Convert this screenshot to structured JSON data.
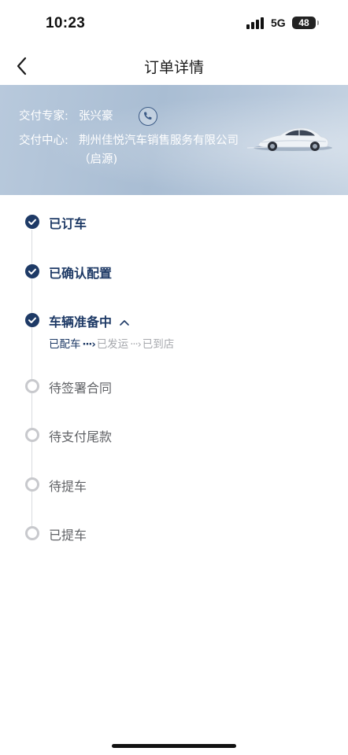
{
  "status_bar": {
    "time": "10:23",
    "network": "5G",
    "battery": "48"
  },
  "nav": {
    "title": "订单详情",
    "back_icon": "chevron-left-icon"
  },
  "delivery_info": {
    "expert_label": "交付专家:",
    "expert_name": "张兴豪",
    "phone_icon": "phone-icon",
    "center_label": "交付中心:",
    "center_name": "荆州佳悦汽车销售服务有限公司（启源)"
  },
  "steps": [
    {
      "label": "已订车",
      "status": "done"
    },
    {
      "label": "已确认配置",
      "status": "done"
    },
    {
      "label": "车辆准备中",
      "status": "done",
      "expanded": true,
      "substeps": [
        {
          "label": "已配车",
          "status": "active"
        },
        {
          "label": "已发运",
          "status": "inactive"
        },
        {
          "label": "已到店",
          "status": "inactive"
        }
      ]
    },
    {
      "label": "待签署合同",
      "status": "pending"
    },
    {
      "label": "待支付尾款",
      "status": "pending"
    },
    {
      "label": "待提车",
      "status": "pending"
    },
    {
      "label": "已提车",
      "status": "pending"
    }
  ],
  "colors": {
    "accent": "#1e3a66",
    "pending": "#c8c9cd",
    "banner": "#b3c6da"
  }
}
